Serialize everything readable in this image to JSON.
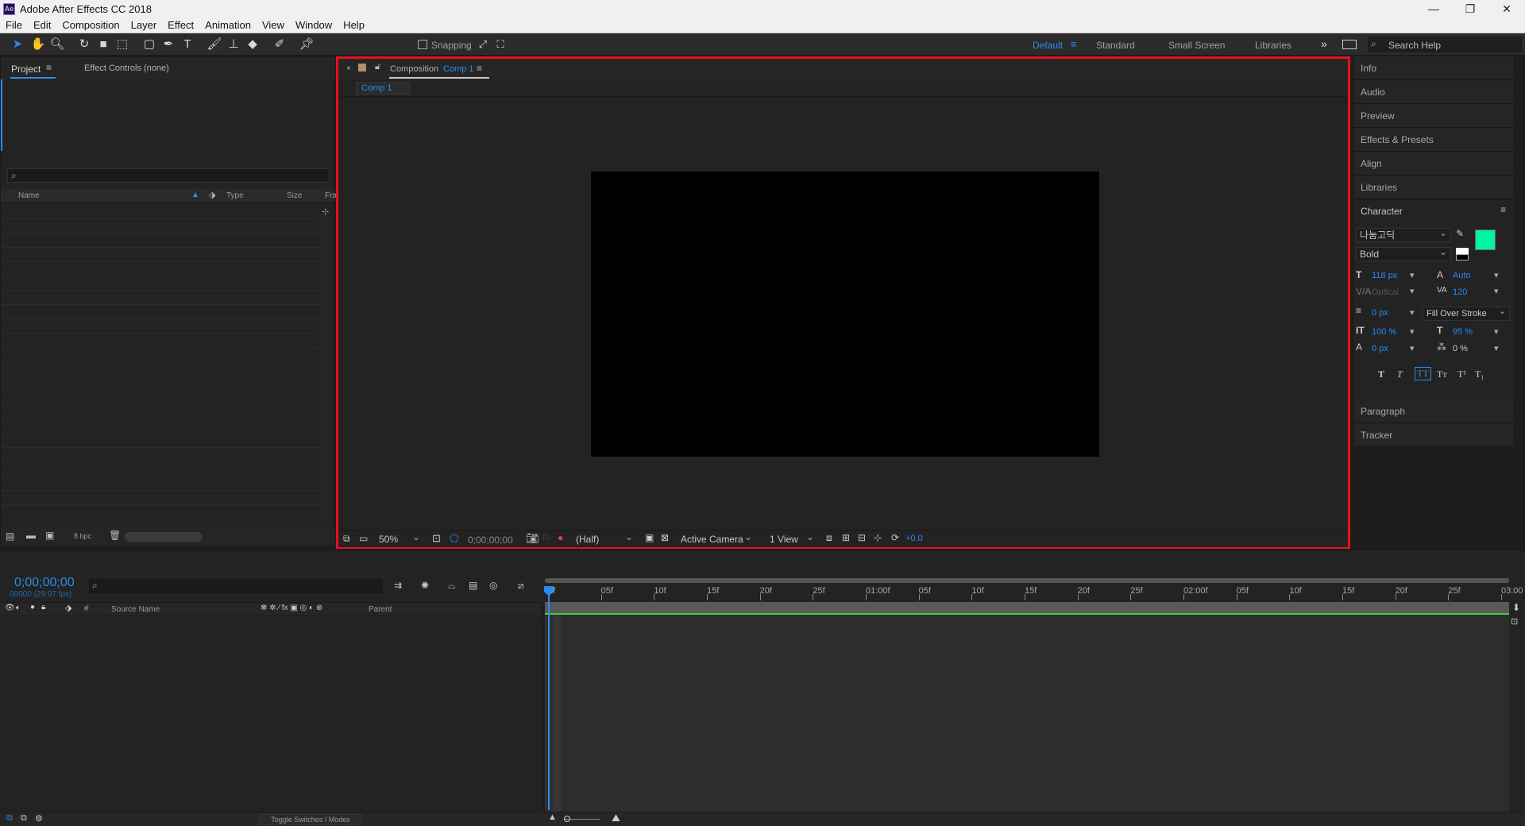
{
  "app": {
    "title": "Adobe After Effects CC 2018",
    "icon": "Ae"
  },
  "window_controls": {
    "minimize": "—",
    "restore": "❐",
    "close": "✕"
  },
  "menu": [
    "File",
    "Edit",
    "Composition",
    "Layer",
    "Effect",
    "Animation",
    "View",
    "Window",
    "Help"
  ],
  "toolbar": {
    "snapping_label": "Snapping",
    "workspaces": [
      "Default",
      "Standard",
      "Small Screen",
      "Libraries"
    ],
    "overflow": "»",
    "search_placeholder": "Search Help"
  },
  "project_panel": {
    "tab_project": "Project",
    "tab_effect_controls": "Effect Controls (none)",
    "search_placeholder": "",
    "columns": {
      "name": "Name",
      "type": "Type",
      "size": "Size",
      "frame": "Fra"
    },
    "bpc": "8 bpc"
  },
  "composition_panel": {
    "tab_prefix": "Composition",
    "tab_name": "Comp 1",
    "comp_tab": "Comp 1",
    "zoom": "50%",
    "timecode": "0;00;00;00",
    "resolution": "(Half)",
    "camera": "Active Camera",
    "views": "1 View",
    "exposure": "+0.0"
  },
  "right_panel": {
    "items": [
      "Info",
      "Audio",
      "Preview",
      "Effects & Presets",
      "Align",
      "Libraries"
    ],
    "character": {
      "title": "Character",
      "font": "나눔고딕",
      "style": "Bold",
      "fill_color": "#00f5a0",
      "font_size": "118 px",
      "leading": "Auto",
      "kerning": "Optical",
      "tracking": "120",
      "stroke_width": "0 px",
      "stroke_mode": "Fill Over Stroke",
      "vertical_scale": "100 %",
      "horizontal_scale": "95 %",
      "baseline_shift": "0 px",
      "tsume": "0 %"
    },
    "bottom_items": [
      "Paragraph",
      "Tracker"
    ]
  },
  "timeline": {
    "timecode": "0;00;00;00",
    "frame_info": "00000 (29.97 fps)",
    "columns": {
      "source_name": "Source Name",
      "parent": "Parent"
    },
    "ruler_ticks": [
      "0f",
      "05f",
      "10f",
      "15f",
      "20f",
      "25f",
      "01:00f",
      "05f",
      "10f",
      "15f",
      "20f",
      "25f",
      "02:00f",
      "05f",
      "10f",
      "15f",
      "20f",
      "25f",
      "03:00"
    ],
    "toggle_label": "Toggle Switches / Modes"
  }
}
